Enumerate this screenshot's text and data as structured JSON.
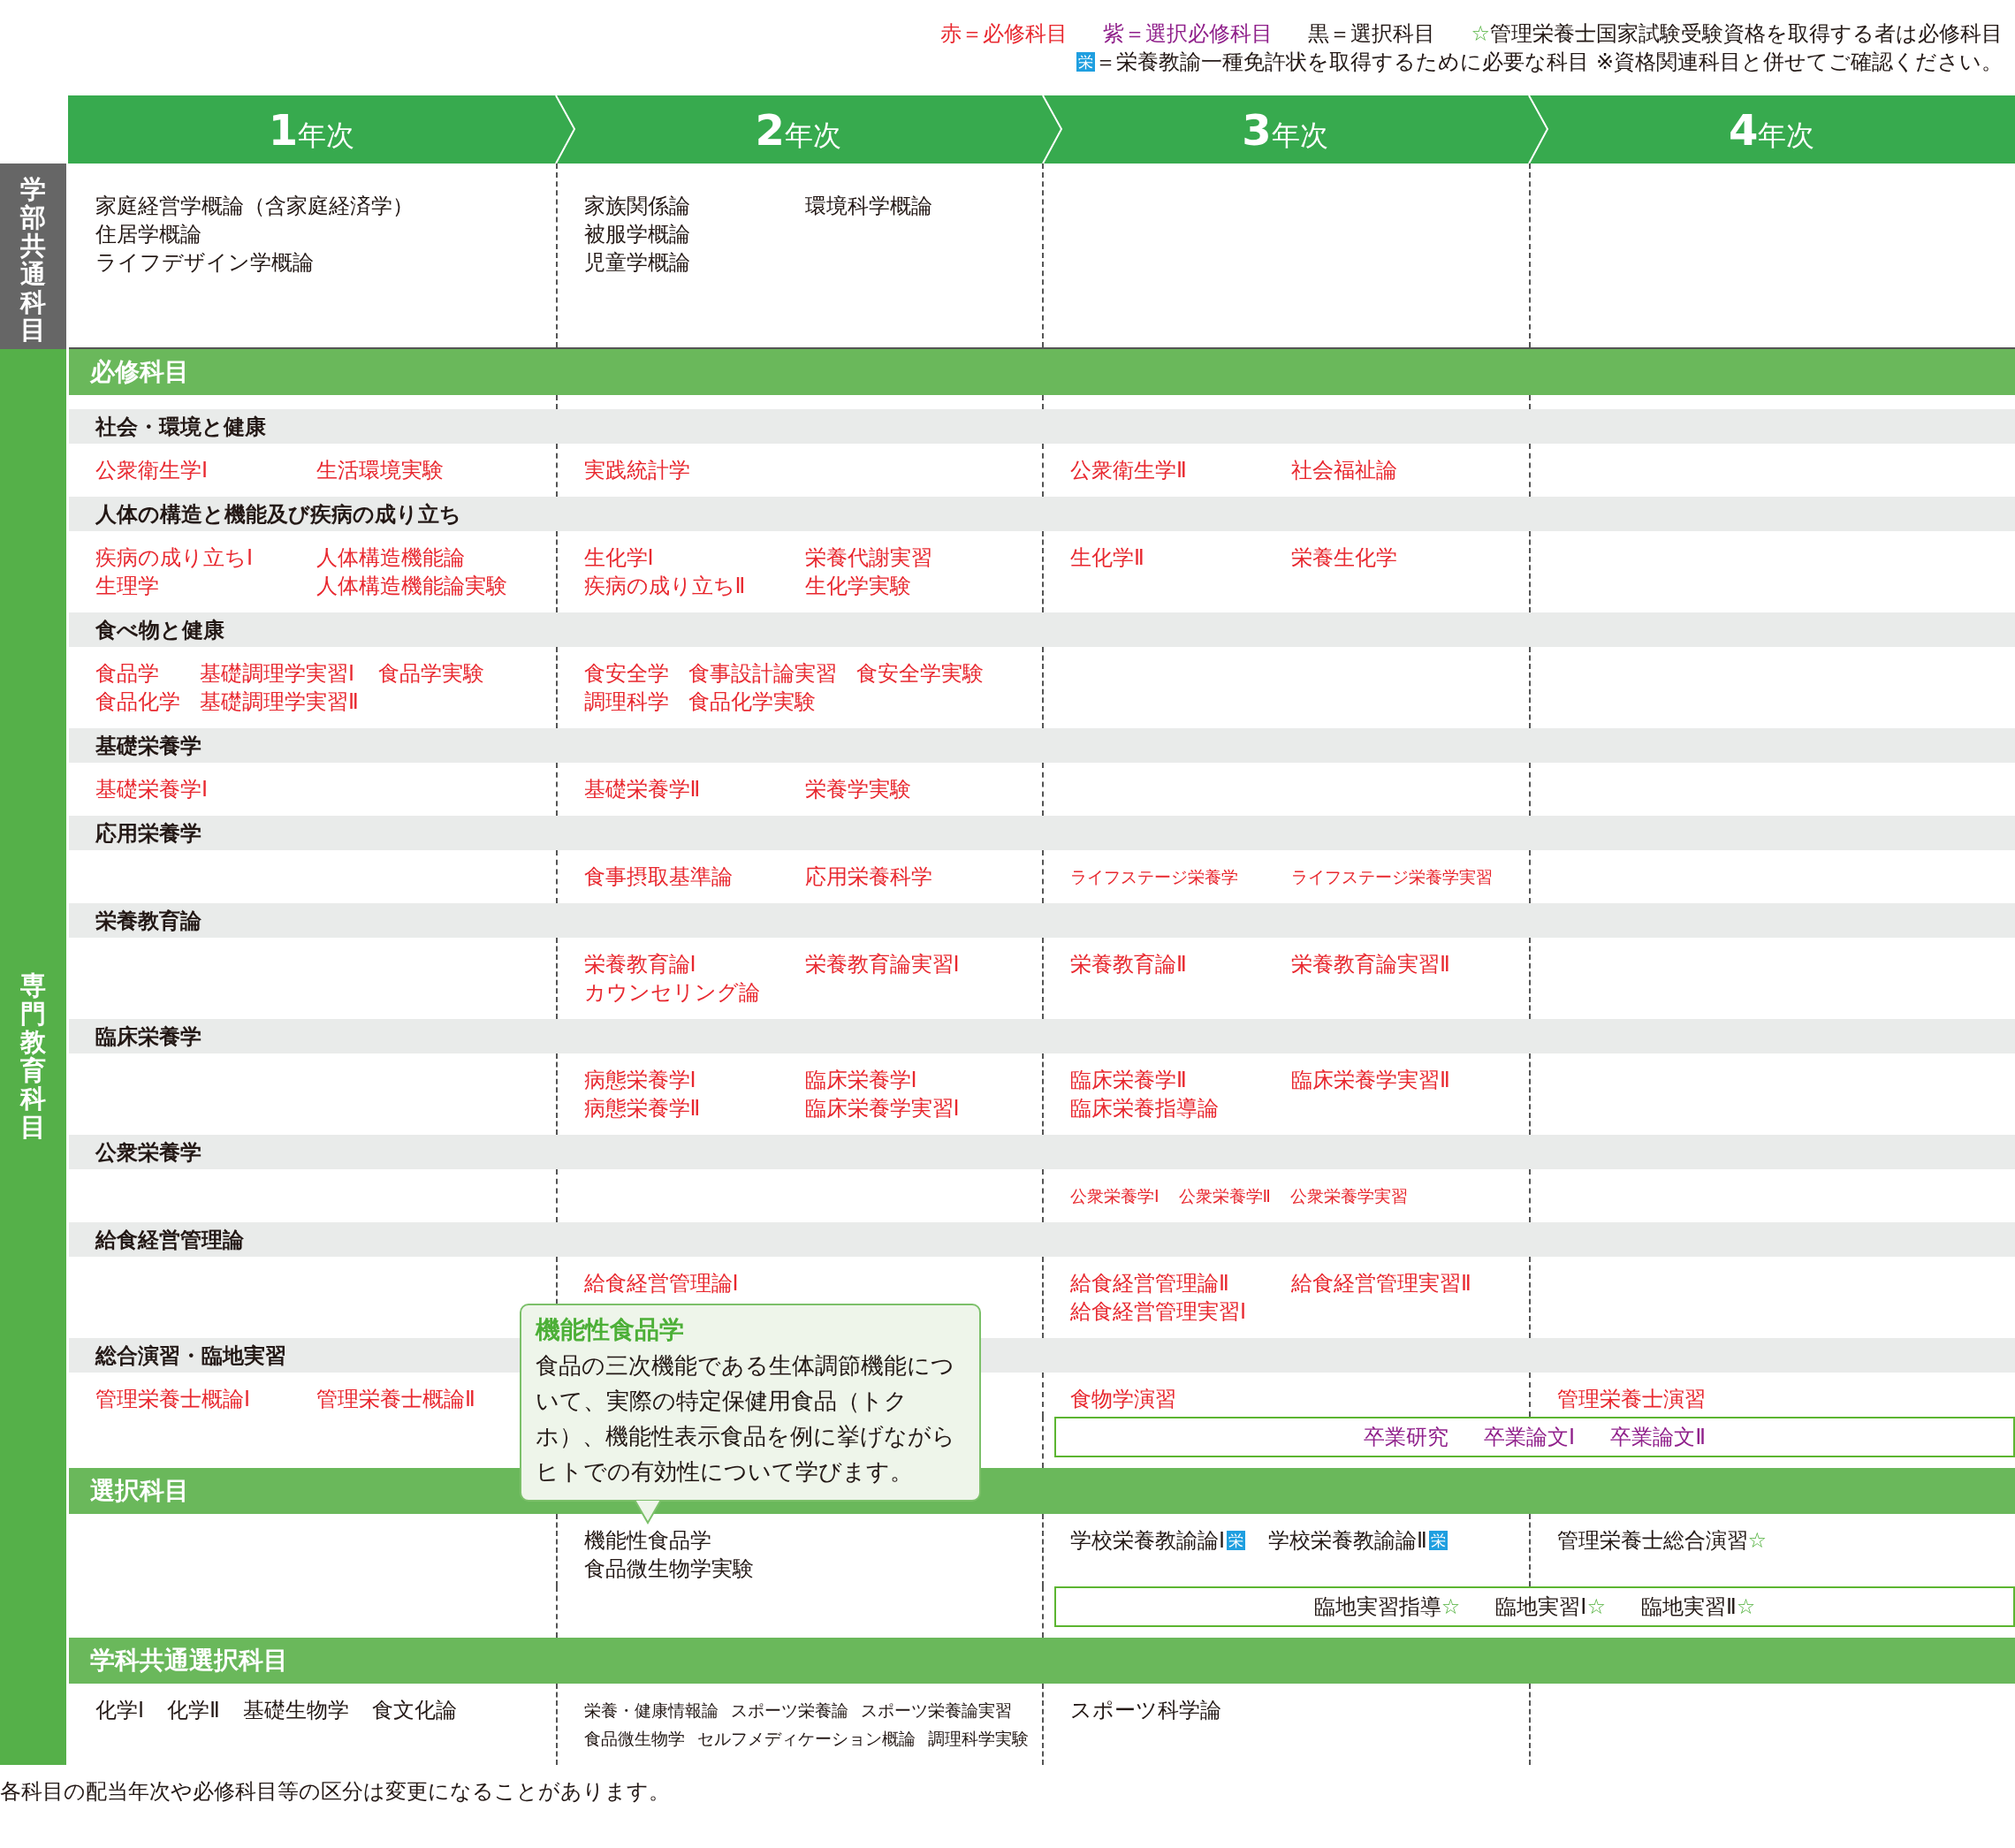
{
  "legend": {
    "lines": [
      [
        {
          "kind": "required",
          "text": "赤＝必修科目"
        },
        {
          "kind": "selective_required",
          "text": "紫＝選択必修科目"
        },
        {
          "kind": "elective",
          "text": "黒＝選択科目"
        },
        {
          "kind": "elective",
          "mark": "☆",
          "text": "管理栄養士国家試験受験資格を取得する者は必修科目"
        }
      ],
      [
        {
          "kind": "elective",
          "badge": "栄",
          "text": "＝栄養教諭一種免許状を取得するために必要な科目 ※資格関連科目と併せてご確認ください。"
        }
      ]
    ]
  },
  "years": [
    {
      "number": "1",
      "label": "年次"
    },
    {
      "number": "2",
      "label": "年次"
    },
    {
      "number": "3",
      "label": "年次"
    },
    {
      "number": "4",
      "label": "年次"
    }
  ],
  "common": {
    "label": "学部共通科目",
    "cells": [
      {
        "columns": [
          [
            {
              "name": "家庭経営学概論（含家庭経済学）",
              "kind": "elective"
            },
            {
              "name": "住居学概論",
              "kind": "elective"
            },
            {
              "name": "ライフデザイン学概論",
              "kind": "elective"
            }
          ]
        ]
      },
      {
        "columns": [
          [
            {
              "name": "家族関係論",
              "kind": "elective"
            },
            {
              "name": "被服学概論",
              "kind": "elective"
            },
            {
              "name": "児童学概論",
              "kind": "elective"
            }
          ],
          [
            {
              "name": "環境科学概論",
              "kind": "elective"
            }
          ]
        ]
      },
      {},
      {}
    ]
  },
  "specialized": {
    "label": "専門教育科目",
    "groups": [
      {
        "title": "必修科目",
        "categories": [
          {
            "title": "社会・環境と健康",
            "cells": [
              {
                "columns": [
                  [
                    {
                      "name": "公衆衛生学Ⅰ",
                      "kind": "required"
                    }
                  ],
                  [
                    {
                      "name": "生活環境実験",
                      "kind": "required"
                    }
                  ]
                ]
              },
              {
                "columns": [
                  [
                    {
                      "name": "実践統計学",
                      "kind": "required"
                    }
                  ]
                ]
              },
              {
                "columns": [
                  [
                    {
                      "name": "公衆衛生学Ⅱ",
                      "kind": "required"
                    }
                  ],
                  [
                    {
                      "name": "社会福祉論",
                      "kind": "required"
                    }
                  ]
                ]
              },
              {}
            ]
          },
          {
            "title": "人体の構造と機能及び疾病の成り立ち",
            "cells": [
              {
                "columns": [
                  [
                    {
                      "name": "疾病の成り立ちⅠ",
                      "kind": "required"
                    },
                    {
                      "name": "生理学",
                      "kind": "required"
                    }
                  ],
                  [
                    {
                      "name": "人体構造機能論",
                      "kind": "required"
                    },
                    {
                      "name": "人体構造機能論実験",
                      "kind": "required"
                    }
                  ]
                ]
              },
              {
                "columns": [
                  [
                    {
                      "name": "生化学Ⅰ",
                      "kind": "required"
                    },
                    {
                      "name": "疾病の成り立ちⅡ",
                      "kind": "required"
                    }
                  ],
                  [
                    {
                      "name": "栄養代謝実習",
                      "kind": "required"
                    },
                    {
                      "name": "生化学実験",
                      "kind": "required"
                    }
                  ]
                ]
              },
              {
                "columns": [
                  [
                    {
                      "name": "生化学Ⅱ",
                      "kind": "required"
                    }
                  ],
                  [
                    {
                      "name": "栄養生化学",
                      "kind": "required"
                    }
                  ]
                ]
              },
              {}
            ]
          },
          {
            "title": "食べ物と健康",
            "cells": [
              {
                "columns": [
                  [
                    {
                      "name": "食品学",
                      "kind": "required"
                    },
                    {
                      "name": "食品化学",
                      "kind": "required"
                    }
                  ],
                  [
                    {
                      "name": "基礎調理学実習Ⅰ",
                      "kind": "required"
                    },
                    {
                      "name": "基礎調理学実習Ⅱ",
                      "kind": "required"
                    }
                  ],
                  [
                    {
                      "name": "食品学実験",
                      "kind": "required"
                    }
                  ]
                ]
              },
              {
                "columns": [
                  [
                    {
                      "name": "食安全学",
                      "kind": "required"
                    },
                    {
                      "name": "調理科学",
                      "kind": "required"
                    }
                  ],
                  [
                    {
                      "name": "食事設計論実習",
                      "kind": "required"
                    },
                    {
                      "name": "食品化学実験",
                      "kind": "required"
                    }
                  ],
                  [
                    {
                      "name": "食安全学実験",
                      "kind": "required"
                    }
                  ]
                ]
              },
              {},
              {}
            ]
          },
          {
            "title": "基礎栄養学",
            "cells": [
              {
                "columns": [
                  [
                    {
                      "name": "基礎栄養学Ⅰ",
                      "kind": "required"
                    }
                  ]
                ]
              },
              {
                "columns": [
                  [
                    {
                      "name": "基礎栄養学Ⅱ",
                      "kind": "required"
                    }
                  ],
                  [
                    {
                      "name": "栄養学実験",
                      "kind": "required"
                    }
                  ]
                ]
              },
              {},
              {}
            ]
          },
          {
            "title": "応用栄養学",
            "cells": [
              {},
              {
                "columns": [
                  [
                    {
                      "name": "食事摂取基準論",
                      "kind": "required"
                    }
                  ],
                  [
                    {
                      "name": "応用栄養科学",
                      "kind": "required"
                    }
                  ]
                ]
              },
              {
                "dense": true,
                "columns": [
                  [
                    {
                      "name": "ライフステージ栄養学",
                      "kind": "required"
                    }
                  ],
                  [
                    {
                      "name": "ライフステージ栄養学実習",
                      "kind": "required"
                    }
                  ]
                ]
              },
              {}
            ]
          },
          {
            "title": "栄養教育論",
            "cells": [
              {},
              {
                "columns": [
                  [
                    {
                      "name": "栄養教育論Ⅰ",
                      "kind": "required"
                    },
                    {
                      "name": "カウンセリング論",
                      "kind": "required"
                    }
                  ],
                  [
                    {
                      "name": "栄養教育論実習Ⅰ",
                      "kind": "required"
                    }
                  ]
                ]
              },
              {
                "columns": [
                  [
                    {
                      "name": "栄養教育論Ⅱ",
                      "kind": "required"
                    }
                  ],
                  [
                    {
                      "name": "栄養教育論実習Ⅱ",
                      "kind": "required"
                    }
                  ]
                ]
              },
              {}
            ]
          },
          {
            "title": "臨床栄養学",
            "cells": [
              {},
              {
                "columns": [
                  [
                    {
                      "name": "病態栄養学Ⅰ",
                      "kind": "required"
                    },
                    {
                      "name": "病態栄養学Ⅱ",
                      "kind": "required"
                    }
                  ],
                  [
                    {
                      "name": "臨床栄養学Ⅰ",
                      "kind": "required"
                    },
                    {
                      "name": "臨床栄養学実習Ⅰ",
                      "kind": "required"
                    }
                  ]
                ]
              },
              {
                "columns": [
                  [
                    {
                      "name": "臨床栄養学Ⅱ",
                      "kind": "required"
                    },
                    {
                      "name": "臨床栄養指導論",
                      "kind": "required"
                    }
                  ],
                  [
                    {
                      "name": "臨床栄養学実習Ⅱ",
                      "kind": "required"
                    }
                  ]
                ]
              },
              {}
            ]
          },
          {
            "title": "公衆栄養学",
            "cells": [
              {},
              {},
              {
                "dense": true,
                "columns": [
                  [
                    {
                      "name": "公衆栄養学Ⅰ",
                      "kind": "required"
                    }
                  ],
                  [
                    {
                      "name": "公衆栄養学Ⅱ",
                      "kind": "required"
                    }
                  ],
                  [
                    {
                      "name": "公衆栄養学実習",
                      "kind": "required"
                    }
                  ]
                ]
              },
              {}
            ]
          },
          {
            "title": "給食経営管理論",
            "cells": [
              {},
              {
                "columns": [
                  [
                    {
                      "name": "給食経営管理論Ⅰ",
                      "kind": "required"
                    }
                  ]
                ]
              },
              {
                "columns": [
                  [
                    {
                      "name": "給食経営管理論Ⅱ",
                      "kind": "required"
                    },
                    {
                      "name": "給食経営管理実習Ⅰ",
                      "kind": "required"
                    }
                  ],
                  [
                    {
                      "name": "給食経営管理実習Ⅱ",
                      "kind": "required"
                    }
                  ]
                ]
              },
              {}
            ]
          },
          {
            "title": "総合演習・臨地実習",
            "cells": [
              {
                "columns": [
                  [
                    {
                      "name": "管理栄養士概論Ⅰ",
                      "kind": "required"
                    }
                  ],
                  [
                    {
                      "name": "管理栄養士概論Ⅱ",
                      "kind": "required"
                    }
                  ]
                ]
              },
              {},
              {
                "columns": [
                  [
                    {
                      "name": "食物学演習",
                      "kind": "required"
                    }
                  ]
                ]
              },
              {
                "columns": [
                  [
                    {
                      "name": "管理栄養士演習",
                      "kind": "required"
                    }
                  ]
                ]
              }
            ],
            "span": [
              {
                "name": "卒業研究",
                "kind": "selective_required"
              },
              {
                "name": "卒業論文Ⅰ",
                "kind": "selective_required"
              },
              {
                "name": "卒業論文Ⅱ",
                "kind": "selective_required"
              }
            ]
          }
        ]
      },
      {
        "title": "選択科目",
        "callout": {
          "title": "機能性食品学",
          "text": "食品の三次機能である生体調節機能について、実際の特定保健用食品（トクホ）、機能性表示食品を例に挙げながらヒトでの有効性について学びます。"
        },
        "categories": [
          {
            "cells": [
              {},
              {
                "columns": [
                  [
                    {
                      "name": "機能性食品学",
                      "kind": "elective"
                    },
                    {
                      "name": "食品微生物学実験",
                      "kind": "elective"
                    }
                  ]
                ]
              },
              {
                "lines": [
                  [
                    {
                      "name": "学校栄養教諭論Ⅰ",
                      "kind": "elective",
                      "badge": "栄"
                    },
                    {
                      "name": "学校栄養教諭論Ⅱ",
                      "kind": "elective",
                      "badge": "栄"
                    }
                  ]
                ]
              },
              {
                "columns": [
                  [
                    {
                      "name": "管理栄養士総合演習",
                      "kind": "elective",
                      "mark": "☆"
                    }
                  ]
                ]
              }
            ],
            "span": [
              {
                "name": "臨地実習指導",
                "kind": "elective",
                "mark": "☆"
              },
              {
                "name": "臨地実習Ⅰ",
                "kind": "elective",
                "mark": "☆"
              },
              {
                "name": "臨地実習Ⅱ",
                "kind": "elective",
                "mark": "☆"
              }
            ]
          }
        ]
      },
      {
        "title": "学科共通選択科目",
        "categories": [
          {
            "cells": [
              {
                "lines": [
                  [
                    {
                      "name": "化学Ⅰ",
                      "kind": "elective"
                    },
                    {
                      "name": "化学Ⅱ",
                      "kind": "elective"
                    },
                    {
                      "name": "基礎生物学",
                      "kind": "elective"
                    },
                    {
                      "name": "食文化論",
                      "kind": "elective"
                    }
                  ]
                ]
              },
              {
                "dense": true,
                "lines": [
                  [
                    {
                      "name": "栄養・健康情報論",
                      "kind": "elective"
                    },
                    {
                      "name": "スポーツ栄養論",
                      "kind": "elective"
                    },
                    {
                      "name": "スポーツ栄養論実習",
                      "kind": "elective"
                    }
                  ],
                  [
                    {
                      "name": "食品微生物学",
                      "kind": "elective"
                    },
                    {
                      "name": "セルフメディケーション概論",
                      "kind": "elective"
                    },
                    {
                      "name": "調理科学実験",
                      "kind": "elective"
                    }
                  ]
                ]
              },
              {
                "lines": [
                  [
                    {
                      "name": "スポーツ科学論",
                      "kind": "elective"
                    }
                  ]
                ]
              },
              {}
            ]
          }
        ]
      }
    ]
  },
  "footnote": "各科目の配当年次や必修科目等の区分は変更になることがあります。"
}
